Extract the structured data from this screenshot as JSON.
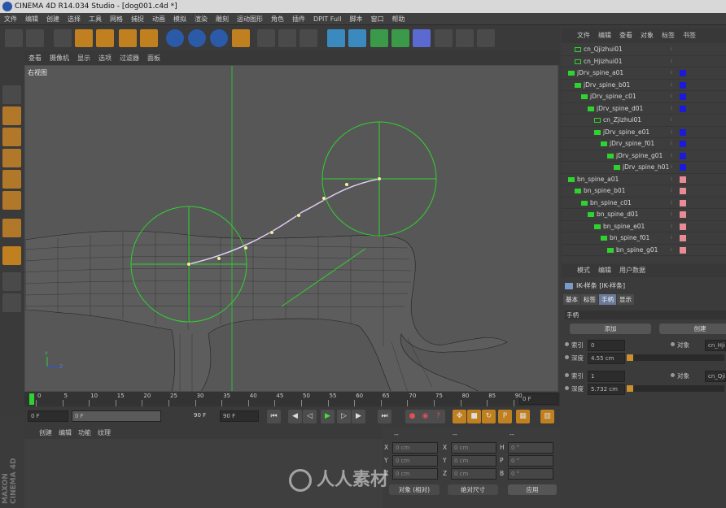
{
  "title": "CINEMA 4D R14.034 Studio - [dog001.c4d *]",
  "menu": [
    "文件",
    "编辑",
    "创建",
    "选择",
    "工具",
    "网格",
    "捕捉",
    "动画",
    "模拟",
    "渲染",
    "雕刻",
    "运动图形",
    "角色",
    "插件",
    "DPIT Full",
    "脚本",
    "窗口",
    "帮助"
  ],
  "toolbar_icons": [
    "undo-icon",
    "redo-icon",
    "select-icon",
    "move-icon",
    "scale-icon",
    "rotate-icon",
    "add-icon",
    "x-axis-icon",
    "y-axis-icon",
    "z-axis-icon",
    "world-icon",
    "render-view-icon",
    "render-icon",
    "render-settings-icon",
    "cube-icon",
    "spline-icon",
    "subdivision-icon",
    "array-icon",
    "deformer-icon",
    "floor-icon",
    "camera-icon",
    "light-icon"
  ],
  "left_tools": [
    "model-icon",
    "texture-icon",
    "polygon-grid-icon",
    "points-icon",
    "edges-icon",
    "polygons-icon",
    "axis-icon",
    "magnet-icon",
    "lock-grid-icon",
    "snap-icon"
  ],
  "viewport": {
    "menu": [
      "查看",
      "摄像机",
      "显示",
      "选项",
      "过滤器",
      "面板"
    ],
    "label": "右视图"
  },
  "timeline": {
    "ticks": [
      "0",
      "5",
      "10",
      "15",
      "20",
      "25",
      "30",
      "35",
      "40",
      "45",
      "50",
      "55",
      "60",
      "65",
      "70",
      "75",
      "80",
      "85",
      "90"
    ],
    "current_frame": "0 F"
  },
  "transport": {
    "start": "0 F",
    "range_start": "0 F",
    "range_end": "90 F",
    "end": "90 F"
  },
  "material_panel": {
    "menu": [
      "创建",
      "编辑",
      "功能",
      "纹理"
    ]
  },
  "coord_panel": {
    "header_left": "--",
    "header_mid": "--",
    "header_right": "--",
    "rows": [
      {
        "a": "X",
        "av": "0 cm",
        "b": "X",
        "bv": "0 cm",
        "c": "H",
        "cv": "0 °"
      },
      {
        "a": "Y",
        "av": "0 cm",
        "b": "Y",
        "bv": "0 cm",
        "c": "P",
        "cv": "0 °"
      },
      {
        "a": "Z",
        "av": "0 cm",
        "b": "Z",
        "bv": "0 cm",
        "c": "B",
        "cv": "0 °"
      }
    ],
    "mode": "对象 (相对)",
    "size_mode": "绝对尺寸",
    "apply": "应用"
  },
  "object_panel": {
    "menu": [
      "文件",
      "编辑",
      "查看",
      "对象",
      "标签",
      "书签"
    ],
    "objects": [
      {
        "name": "cn_Qjizhui01",
        "indent": 1,
        "color": "",
        "type": "null"
      },
      {
        "name": "cn_Hjizhui01",
        "indent": 1,
        "color": "",
        "type": "null"
      },
      {
        "name": "jDrv_spine_a01",
        "indent": 0,
        "color": "#1a1adb",
        "type": "joint"
      },
      {
        "name": "jDrv_spine_b01",
        "indent": 1,
        "color": "#1a1adb",
        "type": "joint"
      },
      {
        "name": "jDrv_spine_c01",
        "indent": 2,
        "color": "#1a1adb",
        "type": "joint"
      },
      {
        "name": "jDrv_spine_d01",
        "indent": 3,
        "color": "#1a1adb",
        "type": "joint"
      },
      {
        "name": "cn_Zjizhui01",
        "indent": 4,
        "color": "",
        "type": "null"
      },
      {
        "name": "jDrv_spine_e01",
        "indent": 4,
        "color": "#1a1adb",
        "type": "joint"
      },
      {
        "name": "jDrv_spine_f01",
        "indent": 5,
        "color": "#1a1adb",
        "type": "joint"
      },
      {
        "name": "jDrv_spine_g01",
        "indent": 6,
        "color": "#1a1adb",
        "type": "joint"
      },
      {
        "name": "jDrv_spine_h01",
        "indent": 7,
        "color": "#1a1adb",
        "type": "joint"
      },
      {
        "name": "bn_spine_a01",
        "indent": 0,
        "color": "#e88b95",
        "type": "joint"
      },
      {
        "name": "bn_spine_b01",
        "indent": 1,
        "color": "#e88b95",
        "type": "joint"
      },
      {
        "name": "bn_spine_c01",
        "indent": 2,
        "color": "#e88b95",
        "type": "joint"
      },
      {
        "name": "bn_spine_d01",
        "indent": 3,
        "color": "#e88b95",
        "type": "joint"
      },
      {
        "name": "bn_spine_e01",
        "indent": 4,
        "color": "#e88b95",
        "type": "joint"
      },
      {
        "name": "bn_spine_f01",
        "indent": 5,
        "color": "#e88b95",
        "type": "joint"
      },
      {
        "name": "bn_spine_g01",
        "indent": 6,
        "color": "#e88b95",
        "type": "joint"
      }
    ]
  },
  "attr_panel": {
    "menu": [
      "模式",
      "编辑",
      "用户数据"
    ],
    "object_title": "IK-样条 [IK-样条]",
    "tabs": [
      "基本",
      "标签",
      "手柄",
      "显示"
    ],
    "active_tab": "手柄",
    "section": "手柄",
    "add_label": "添加",
    "create_label": "创建",
    "handles": [
      {
        "index_label": "索引",
        "index": "0",
        "depth_label": "深度",
        "depth": "4.55 cm",
        "object_label": "对象",
        "object": "cn_Hji"
      },
      {
        "index_label": "索引",
        "index": "1",
        "depth_label": "深度",
        "depth": "5.732 cm",
        "object_label": "对象",
        "object": "cn_Qji"
      }
    ]
  },
  "watermark": "人人素材",
  "brand": "MAXON CINEMA 4D",
  "colors": {
    "ik_green": "#2fd32f",
    "spline_white": "#e8e8e8",
    "joint_blue": "#1a1adb",
    "bone_pink": "#e88b95"
  }
}
